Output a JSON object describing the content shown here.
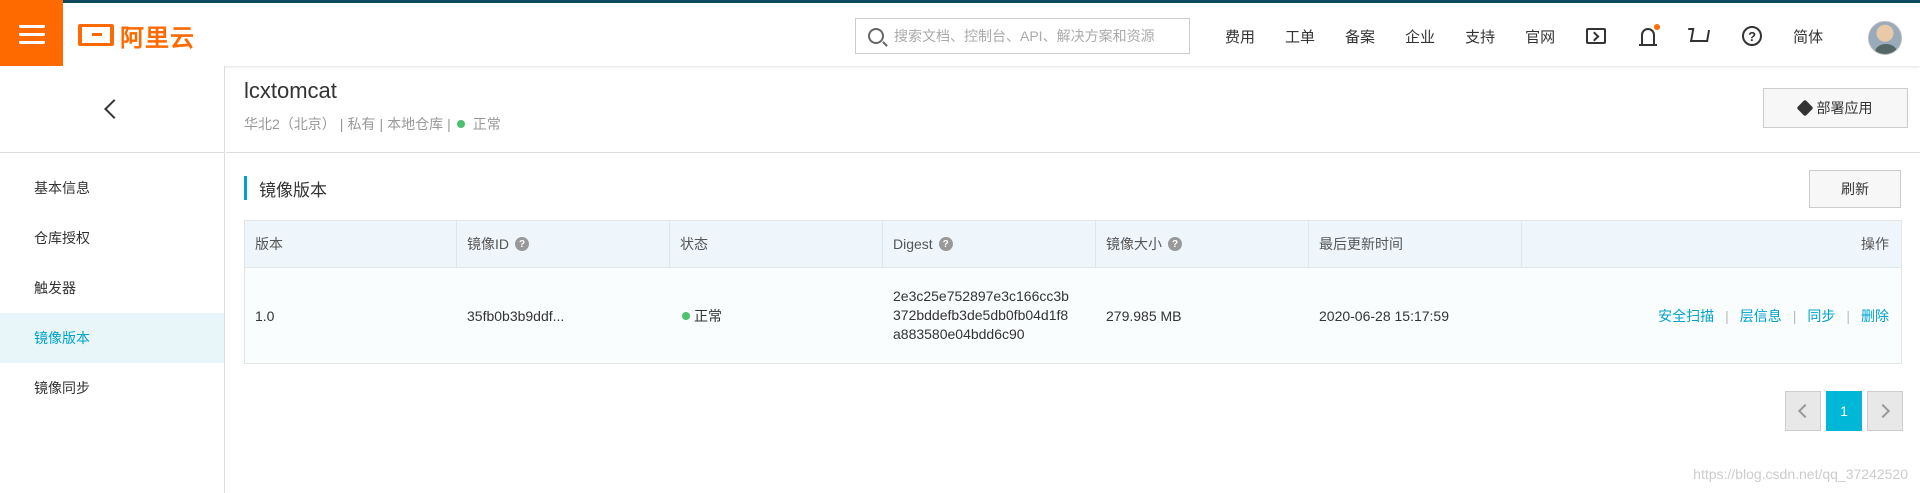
{
  "topbar": {
    "brand": "阿里云",
    "search_placeholder": "搜索文档、控制台、API、解决方案和资源",
    "nav": [
      "费用",
      "工单",
      "备案",
      "企业",
      "支持",
      "官网"
    ],
    "language": "简体"
  },
  "sidebar": {
    "items": [
      {
        "label": "基本信息"
      },
      {
        "label": "仓库授权"
      },
      {
        "label": "触发器"
      },
      {
        "label": "镜像版本",
        "active": true
      },
      {
        "label": "镜像同步"
      }
    ]
  },
  "repo": {
    "name": "lcxtomcat",
    "region": "华北2（北京）",
    "visibility": "私有",
    "type": "本地仓库",
    "status": "正常",
    "sep": "|",
    "deploy_label": "部署应用"
  },
  "section": {
    "title": "镜像版本",
    "refresh_label": "刷新"
  },
  "table": {
    "columns": [
      "版本",
      "镜像ID",
      "状态",
      "Digest",
      "镜像大小",
      "最后更新时间",
      "操作"
    ],
    "rows": [
      {
        "version": "1.0",
        "image_id": "35fb0b3b9ddf...",
        "status": "正常",
        "digest_lines": [
          "2e3c25e752897e3c166cc3b",
          "372bddefb3de5db0fb04d1f8",
          "a883580e04bdd6c90"
        ],
        "size": "279.985 MB",
        "updated": "2020-06-28 15:17:59",
        "actions": [
          "安全扫描",
          "层信息",
          "同步",
          "删除"
        ]
      }
    ]
  },
  "pagination": {
    "current": "1"
  },
  "watermark": "https://blog.csdn.net/qq_37242520",
  "colors": {
    "brand": "#ff6a00",
    "accent": "#00a2ca",
    "status_ok": "#4cc16e"
  }
}
